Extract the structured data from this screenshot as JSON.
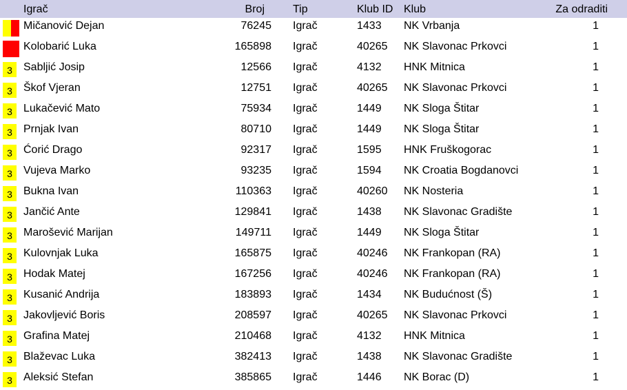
{
  "header": {
    "name": "Igrač",
    "broj": "Broj",
    "tip": "Tip",
    "klub_id": "Klub ID",
    "klub": "Klub",
    "za_odraditi": "Za odraditi"
  },
  "colors": {
    "header_bg": "#cfcfe8",
    "yellow": "#ffff00",
    "red": "#ff0000"
  },
  "rows": [
    {
      "badge": "yellow-red",
      "badge_text": "",
      "name": "Mičanović Dejan",
      "broj": "76245",
      "tip": "Igrač",
      "klub_id": "1433",
      "klub": "NK Vrbanja",
      "za": "1"
    },
    {
      "badge": "red",
      "badge_text": "",
      "name": "Kolobarić Luka",
      "broj": "165898",
      "tip": "Igrač",
      "klub_id": "40265",
      "klub": "NK Slavonac Prkovci",
      "za": "1"
    },
    {
      "badge": "yellow",
      "badge_text": "3",
      "name": "Sabljić Josip",
      "broj": "12566",
      "tip": "Igrač",
      "klub_id": "4132",
      "klub": "HNK Mitnica",
      "za": "1"
    },
    {
      "badge": "yellow",
      "badge_text": "3",
      "name": "Škof Vjeran",
      "broj": "12751",
      "tip": "Igrač",
      "klub_id": "40265",
      "klub": "NK Slavonac Prkovci",
      "za": "1"
    },
    {
      "badge": "yellow",
      "badge_text": "3",
      "name": "Lukačević Mato",
      "broj": "75934",
      "tip": "Igrač",
      "klub_id": "1449",
      "klub": "NK Sloga Štitar",
      "za": "1"
    },
    {
      "badge": "yellow",
      "badge_text": "3",
      "name": "Prnjak Ivan",
      "broj": "80710",
      "tip": "Igrač",
      "klub_id": "1449",
      "klub": "NK Sloga Štitar",
      "za": "1"
    },
    {
      "badge": "yellow",
      "badge_text": "3",
      "name": "Ćorić Drago",
      "broj": "92317",
      "tip": "Igrač",
      "klub_id": "1595",
      "klub": "HNK Fruškogorac",
      "za": "1"
    },
    {
      "badge": "yellow",
      "badge_text": "3",
      "name": "Vujeva Marko",
      "broj": "93235",
      "tip": "Igrač",
      "klub_id": "1594",
      "klub": "NK Croatia Bogdanovci",
      "za": "1"
    },
    {
      "badge": "yellow",
      "badge_text": "3",
      "name": "Bukna Ivan",
      "broj": "110363",
      "tip": "Igrač",
      "klub_id": "40260",
      "klub": "NK Nosteria",
      "za": "1"
    },
    {
      "badge": "yellow",
      "badge_text": "3",
      "name": "Jančić Ante",
      "broj": "129841",
      "tip": "Igrač",
      "klub_id": "1438",
      "klub": "NK Slavonac Gradište",
      "za": "1"
    },
    {
      "badge": "yellow",
      "badge_text": "3",
      "name": "Marošević Marijan",
      "broj": "149711",
      "tip": "Igrač",
      "klub_id": "1449",
      "klub": "NK Sloga Štitar",
      "za": "1"
    },
    {
      "badge": "yellow",
      "badge_text": "3",
      "name": "Kulovnjak Luka",
      "broj": "165875",
      "tip": "Igrač",
      "klub_id": "40246",
      "klub": "NK Frankopan (RA)",
      "za": "1"
    },
    {
      "badge": "yellow",
      "badge_text": "3",
      "name": "Hodak Matej",
      "broj": "167256",
      "tip": "Igrač",
      "klub_id": "40246",
      "klub": "NK Frankopan (RA)",
      "za": "1"
    },
    {
      "badge": "yellow",
      "badge_text": "3",
      "name": "Kusanić Andrija",
      "broj": "183893",
      "tip": "Igrač",
      "klub_id": "1434",
      "klub": "NK Budućnost (Š)",
      "za": "1"
    },
    {
      "badge": "yellow",
      "badge_text": "3",
      "name": "Jakovljević Boris",
      "broj": "208597",
      "tip": "Igrač",
      "klub_id": "40265",
      "klub": "NK Slavonac Prkovci",
      "za": "1"
    },
    {
      "badge": "yellow",
      "badge_text": "3",
      "name": "Grafina Matej",
      "broj": "210468",
      "tip": "Igrač",
      "klub_id": "4132",
      "klub": "HNK Mitnica",
      "za": "1"
    },
    {
      "badge": "yellow",
      "badge_text": "3",
      "name": "Blaževac Luka",
      "broj": "382413",
      "tip": "Igrač",
      "klub_id": "1438",
      "klub": "NK Slavonac Gradište",
      "za": "1"
    },
    {
      "badge": "yellow",
      "badge_text": "3",
      "name": "Aleksić Stefan",
      "broj": "385865",
      "tip": "Igrač",
      "klub_id": "1446",
      "klub": "NK Borac (D)",
      "za": "1"
    }
  ]
}
